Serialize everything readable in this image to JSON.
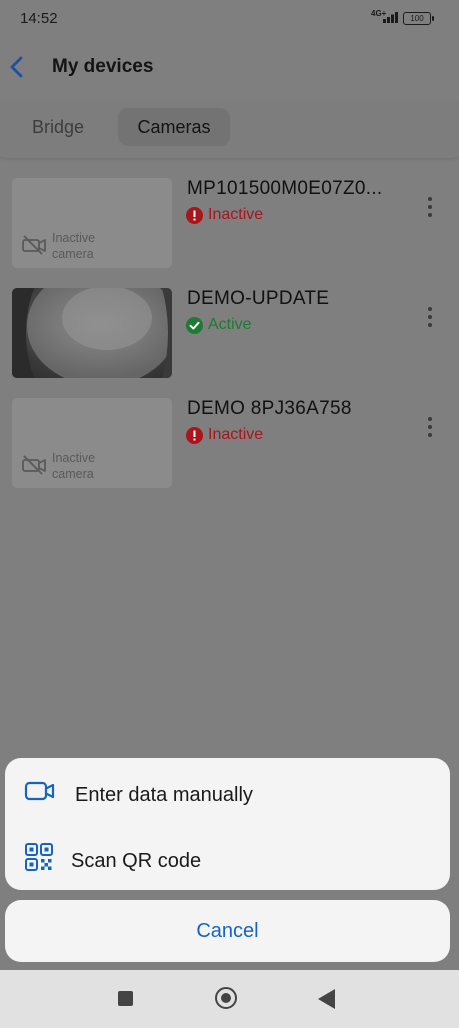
{
  "status_bar": {
    "time": "14:52",
    "network": "4G+",
    "battery": "100"
  },
  "header": {
    "title": "My devices"
  },
  "tabs": [
    {
      "label": "Bridge",
      "selected": false
    },
    {
      "label": "Cameras",
      "selected": true
    }
  ],
  "devices": [
    {
      "name": "MP101500M0E07Z0...",
      "status": "Inactive",
      "thumbnail_text": "Inactive\ncamera"
    },
    {
      "name": "DEMO-UPDATE",
      "status": "Active"
    },
    {
      "name": "DEMO 8PJ36A758",
      "status": "Inactive",
      "thumbnail_text": "Inactive\ncamera"
    }
  ],
  "sheet": {
    "enter_manually_label": "Enter data manually",
    "scan_qr_label": "Scan QR code",
    "cancel_label": "Cancel"
  },
  "colors": {
    "accent": "#1565c0",
    "inactive": "#a8161b",
    "active": "#1f7a30"
  }
}
